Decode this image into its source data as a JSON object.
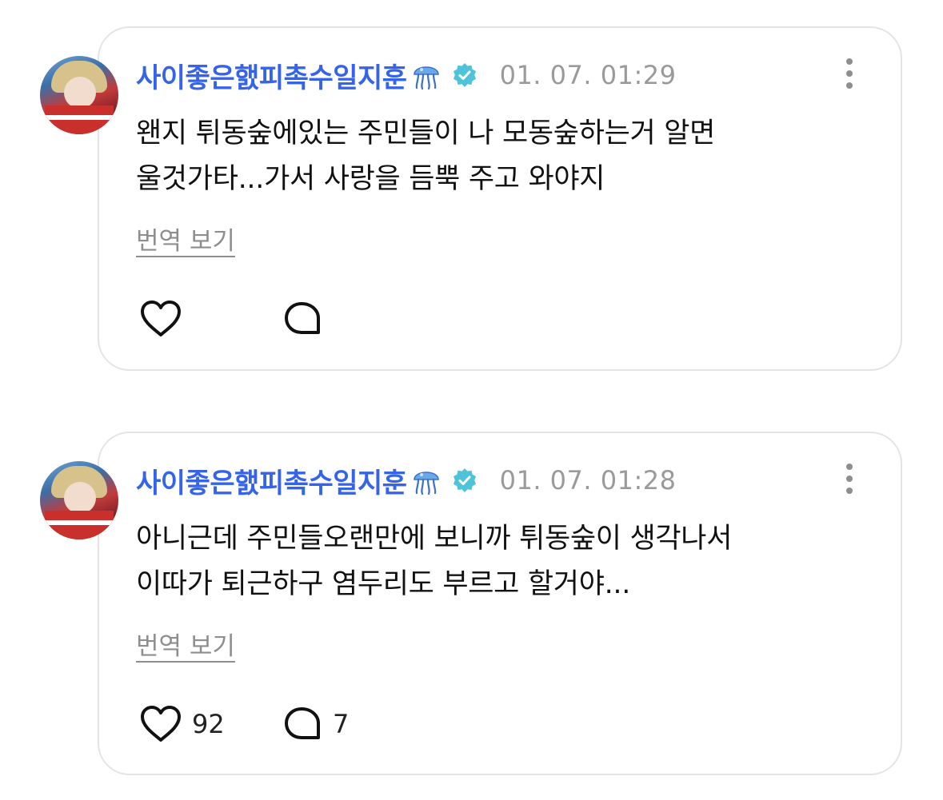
{
  "posts": [
    {
      "username": "사이좋은햀피촉수일지훈",
      "emoji": "jellyfish",
      "verified": true,
      "timestamp": "01. 07. 01:29",
      "lines": [
        "왠지 튀동숲에있는 주민들이 나 모동숲하는거 알면",
        "울것가타...가서 사랑을 듬뿍 주고 와야지"
      ],
      "translate_label": "번역 보기",
      "like_count": "",
      "reply_count": ""
    },
    {
      "username": "사이좋은햀피촉수일지훈",
      "emoji": "jellyfish",
      "verified": true,
      "timestamp": "01. 07. 01:28",
      "lines": [
        "아니근데 주민들오랜만에 보니까 튀동숲이 생각나서",
        "이따가 퇴근하구 염두리도 부르고 할거야..."
      ],
      "translate_label": "번역 보기",
      "like_count": "92",
      "reply_count": "7"
    }
  ],
  "colors": {
    "username": "#3563e9",
    "verified_badge": "#4fc3d9",
    "timestamp": "#9a9a9a",
    "translate": "#8e8e8e"
  }
}
